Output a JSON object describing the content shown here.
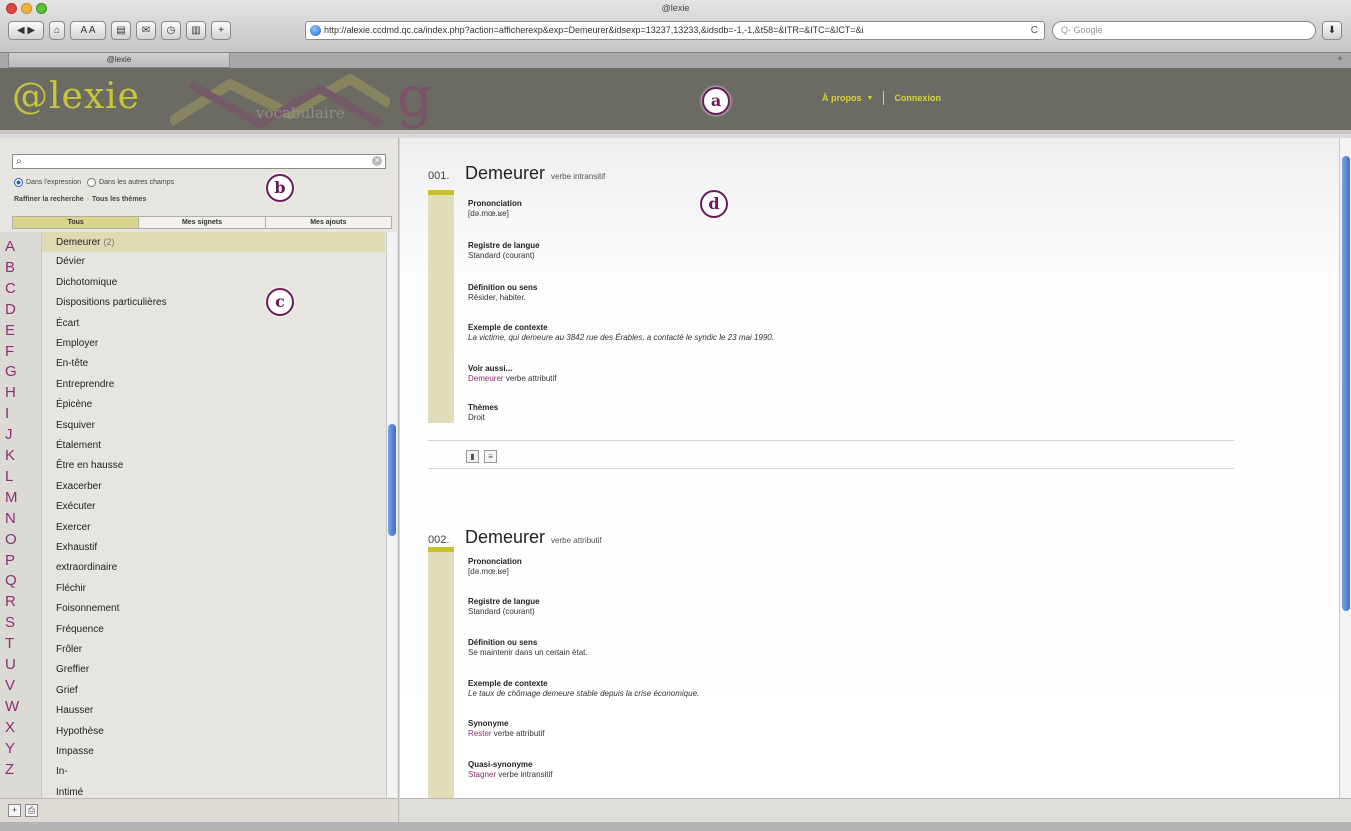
{
  "browser": {
    "window_title": "@lexie",
    "url": "http://alexie.ccdmd.qc.ca/index.php?action=afficherexp&exp=Demeurer&idsexp=13237,13233,&idsdb=-1,-1,&t58=&ITR=&ITC=&ICT=&i",
    "search_placeholder": "Q- Google",
    "tab_title": "@lexie"
  },
  "header": {
    "logo": "@lexie",
    "logo_sub": "vocabulaire",
    "logo_g": "g",
    "nav": [
      {
        "label": "À propos"
      },
      {
        "label": "Connexion"
      }
    ]
  },
  "callouts": {
    "a": "a",
    "b": "b",
    "c": "c",
    "d": "d"
  },
  "search": {
    "scope_options": [
      "Dans l'expression",
      "Dans les autres champs"
    ],
    "refine_label": "Raffiner la recherche",
    "refine_value": "Tous les thèmes",
    "tabs": [
      "Tous",
      "Mes signets",
      "Mes ajouts"
    ]
  },
  "alphabet": [
    "A",
    "B",
    "C",
    "D",
    "E",
    "F",
    "G",
    "H",
    "I",
    "J",
    "K",
    "L",
    "M",
    "N",
    "O",
    "P",
    "Q",
    "R",
    "S",
    "T",
    "U",
    "V",
    "W",
    "X",
    "Y",
    "Z"
  ],
  "words": [
    {
      "label": "Demeurer",
      "count": "(2)"
    },
    {
      "label": "Dévier"
    },
    {
      "label": "Dichotomique"
    },
    {
      "label": "Dispositions particulières"
    },
    {
      "label": "Écart"
    },
    {
      "label": "Employer"
    },
    {
      "label": "En-tête"
    },
    {
      "label": "Entreprendre"
    },
    {
      "label": "Épicène"
    },
    {
      "label": "Esquiver"
    },
    {
      "label": "Étalement"
    },
    {
      "label": "Être en hausse"
    },
    {
      "label": "Exacerber"
    },
    {
      "label": "Exécuter"
    },
    {
      "label": "Exercer"
    },
    {
      "label": "Exhaustif"
    },
    {
      "label": "extraordinaire"
    },
    {
      "label": "Fléchir"
    },
    {
      "label": "Foisonnement"
    },
    {
      "label": "Fréquence"
    },
    {
      "label": "Frôler"
    },
    {
      "label": "Greffier"
    },
    {
      "label": "Grief"
    },
    {
      "label": "Hausser"
    },
    {
      "label": "Hypothèse"
    },
    {
      "label": "Impasse"
    },
    {
      "label": "In-"
    },
    {
      "label": "Intimé"
    }
  ],
  "entries": [
    {
      "num": "001.",
      "headword": "Demeurer",
      "pos": "verbe intransitif",
      "fields": [
        {
          "label": "Prononciation",
          "value": "[də.mœ.ʁe]"
        },
        {
          "label": "Registre de langue",
          "value": "Standard (courant)"
        },
        {
          "label": "Définition ou sens",
          "value": "Résider, habiter."
        },
        {
          "label": "Exemple de contexte",
          "value": "La victime, qui demeure au 3842 rue des Érables, a contacté le syndic le 23 mai 1990."
        },
        {
          "label": "Voir aussi...",
          "link": "Demeurer",
          "value": "verbe attributif"
        },
        {
          "label": "Thèmes",
          "value": "Droit"
        }
      ]
    },
    {
      "num": "002.",
      "headword": "Demeurer",
      "pos": "verbe attributif",
      "fields": [
        {
          "label": "Prononciation",
          "value": "[də.mœ.ʁe]"
        },
        {
          "label": "Registre de langue",
          "value": "Standard (courant)"
        },
        {
          "label": "Définition ou sens",
          "value": "Se maintenir dans un certain état."
        },
        {
          "label": "Exemple de contexte",
          "value": "Le taux de chômage demeure stable depuis la crise économique."
        },
        {
          "label": "Synonyme",
          "link": "Rester",
          "value": "verbe attributif"
        },
        {
          "label": "Quasi-synonyme",
          "link": "Stagner",
          "value": "verbe intransitif"
        }
      ]
    }
  ]
}
